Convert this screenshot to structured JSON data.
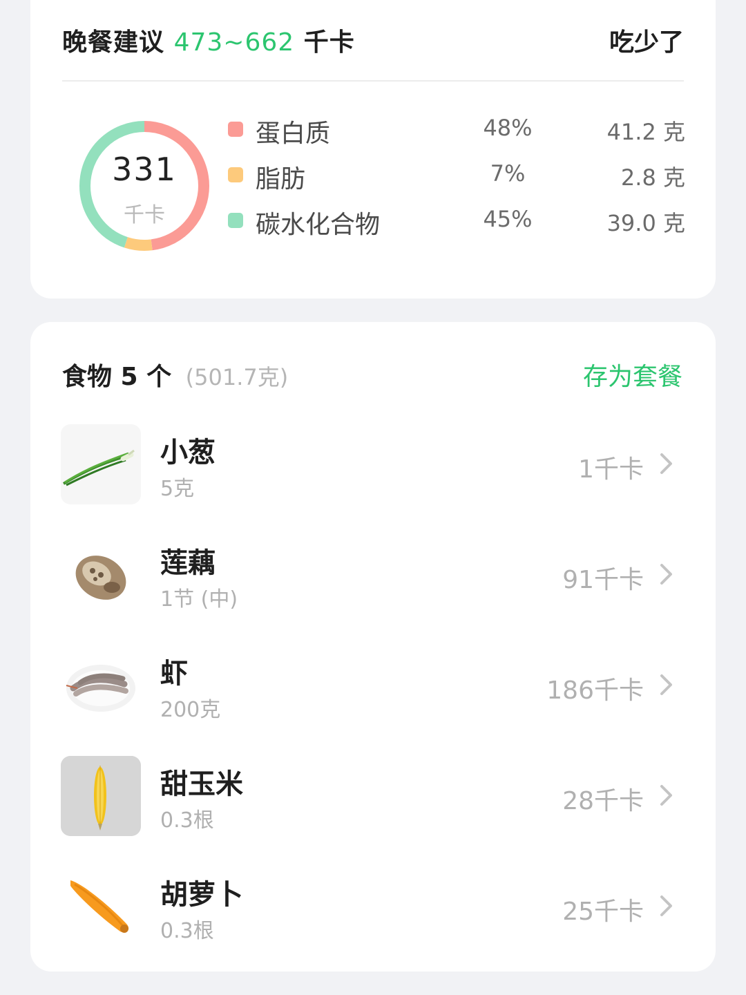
{
  "summary": {
    "meal_label": "晚餐建议",
    "range": "473~662",
    "range_unit": "千卡",
    "status": "吃少了",
    "total_kcal": "331",
    "total_unit": "千卡",
    "macros": [
      {
        "name": "蛋白质",
        "percent": "48%",
        "grams": "41.2 克",
        "fraction": 0.48,
        "color": "#fb9b95"
      },
      {
        "name": "脂肪",
        "percent": "7%",
        "grams": "2.8 克",
        "fraction": 0.07,
        "color": "#fdca7c"
      },
      {
        "name": "碳水化合物",
        "percent": "45%",
        "grams": "39.0 克",
        "fraction": 0.45,
        "color": "#93e0bd"
      }
    ]
  },
  "foods": {
    "title": "食物 5 个",
    "total_weight": "(501.7克)",
    "save_label": "存为套餐",
    "items": [
      {
        "name": "小葱",
        "qty": "5克",
        "kcal": "1千卡",
        "icon": "scallion-icon"
      },
      {
        "name": "莲藕",
        "qty": "1节 (中)",
        "kcal": "91千卡",
        "icon": "lotus-root-icon"
      },
      {
        "name": "虾",
        "qty": "200克",
        "kcal": "186千卡",
        "icon": "shrimp-icon"
      },
      {
        "name": "甜玉米",
        "qty": "0.3根",
        "kcal": "28千卡",
        "icon": "corn-icon"
      },
      {
        "name": "胡萝卜",
        "qty": "0.3根",
        "kcal": "25千卡",
        "icon": "carrot-icon"
      }
    ]
  }
}
